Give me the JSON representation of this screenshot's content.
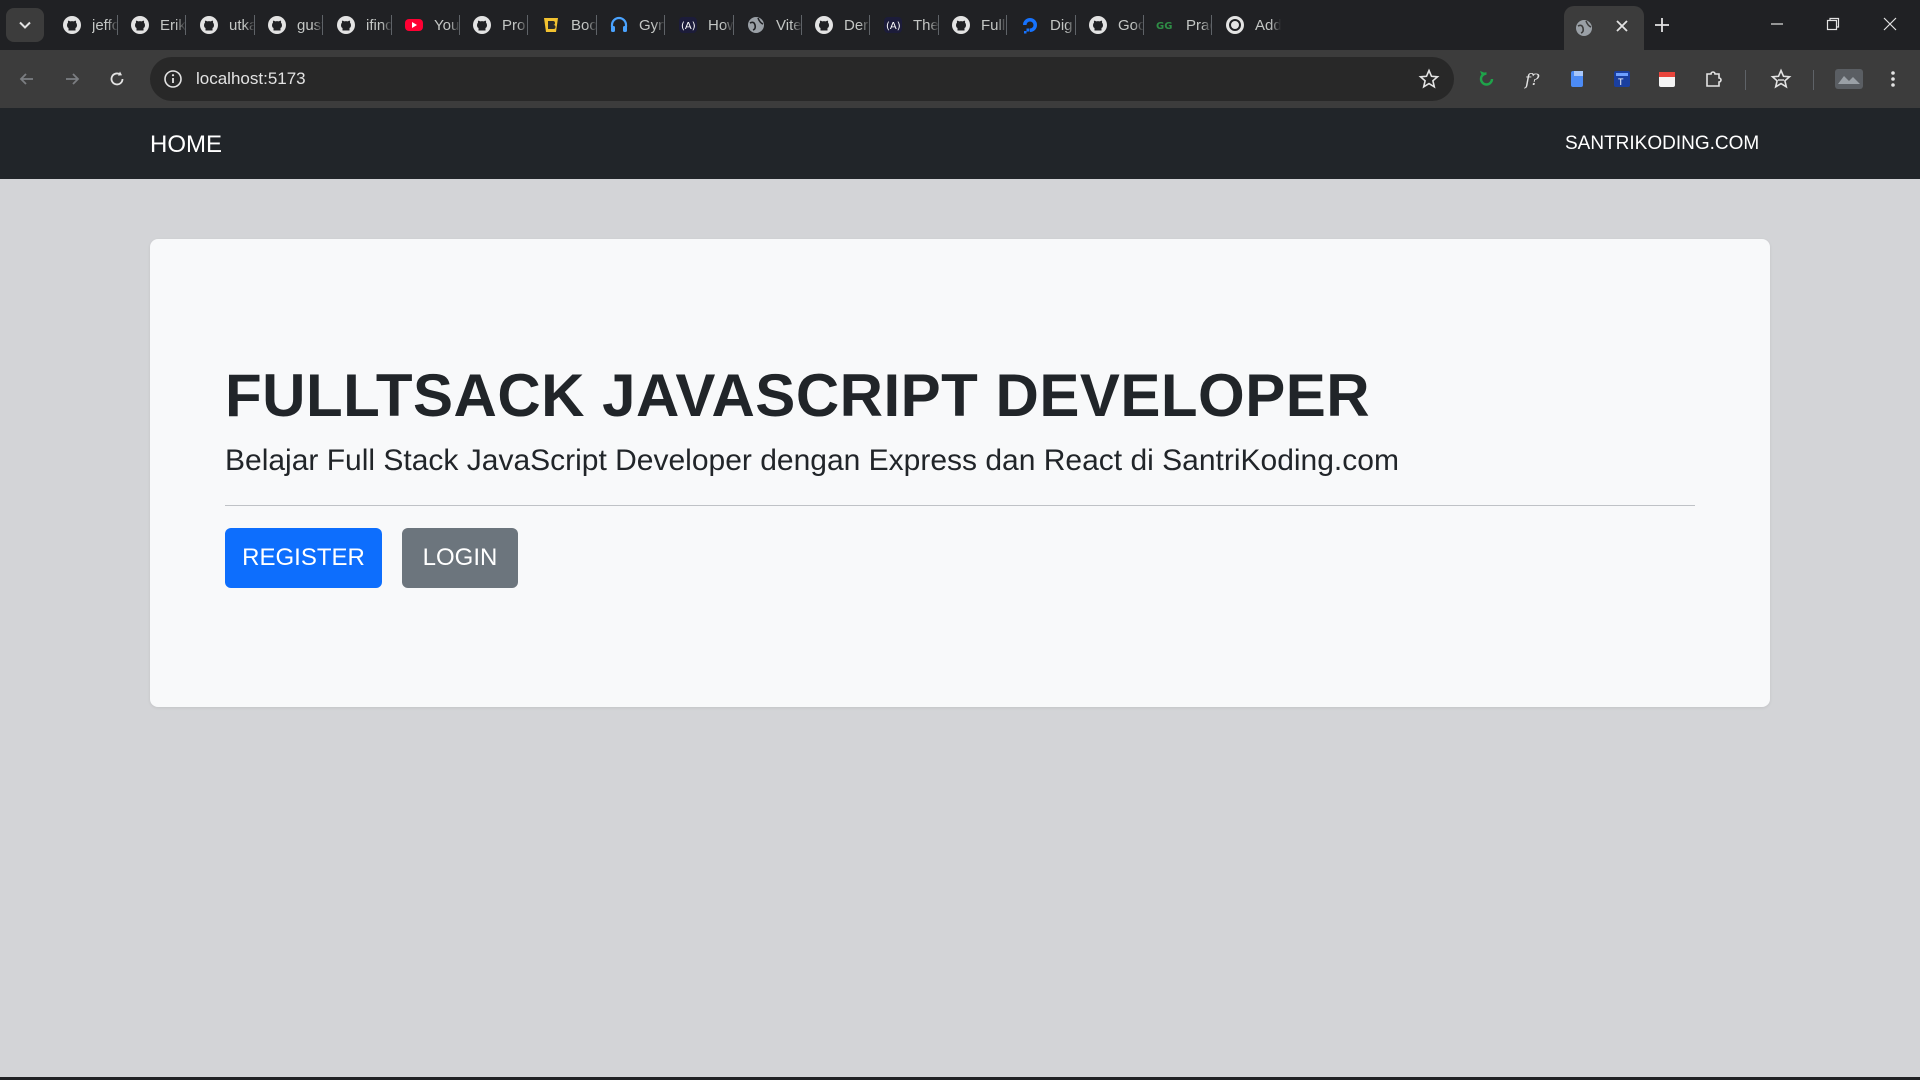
{
  "browser": {
    "tabs": [
      {
        "title": "jeffc",
        "icon": "github-icon"
      },
      {
        "title": "Erik",
        "icon": "github-icon"
      },
      {
        "title": "utka",
        "icon": "github-icon"
      },
      {
        "title": "gust",
        "icon": "github-icon"
      },
      {
        "title": "ifinc",
        "icon": "github-icon"
      },
      {
        "title": "You",
        "icon": "youtube-icon"
      },
      {
        "title": "Pro",
        "icon": "github-icon"
      },
      {
        "title": "Boo",
        "icon": "bootstrap-icon"
      },
      {
        "title": "Gyn",
        "icon": "headphones-icon"
      },
      {
        "title": "How",
        "icon": "ai-icon"
      },
      {
        "title": "Vite",
        "icon": "globe-icon"
      },
      {
        "title": "Der",
        "icon": "github-icon"
      },
      {
        "title": "The",
        "icon": "ai-icon"
      },
      {
        "title": "Full",
        "icon": "github-icon"
      },
      {
        "title": "Dig",
        "icon": "digitalocean-icon"
      },
      {
        "title": "Goc",
        "icon": "github-icon"
      },
      {
        "title": "Prac",
        "icon": "geeksforgeeks-icon"
      },
      {
        "title": "Add",
        "icon": "chatgpt-icon"
      }
    ],
    "active_tab_icon": "globe-icon",
    "address": "localhost:5173"
  },
  "navbar": {
    "brand": "HOME",
    "right_link": "SANTRIKODING.COM"
  },
  "hero": {
    "title": "FULLTSACK JAVASCRIPT DEVELOPER",
    "lead": "Belajar Full Stack JavaScript Developer dengan Express dan React di SantriKoding.com",
    "register_label": "REGISTER",
    "login_label": "LOGIN"
  },
  "colors": {
    "navbar_bg": "#212529",
    "page_bg": "#d3d4d7",
    "card_bg": "#f8f9fa",
    "primary": "#0d6efd",
    "secondary": "#6c757d"
  }
}
